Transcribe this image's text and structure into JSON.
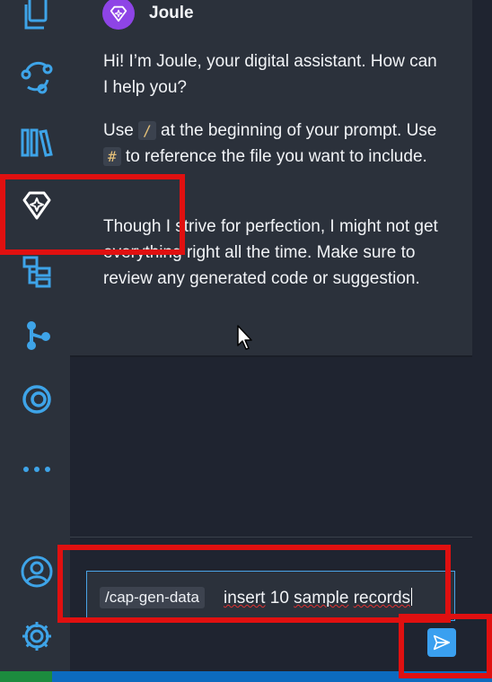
{
  "colors": {
    "activity_bg": "#2b313b",
    "panel_bg": "#1f2430",
    "accent": "#3aa0f0",
    "icon_blue": "#3ea4e8",
    "avatar_purple": "#8e44e6",
    "highlight_red": "#e01010"
  },
  "activity_bar": {
    "icons": [
      "files-icon",
      "source-graph-icon",
      "library-icon",
      "joule-diamond-icon",
      "hierarchy-tree-icon",
      "git-branch-icon",
      "copilot-at-icon",
      "more-icon",
      "account-icon",
      "settings-gear-icon"
    ],
    "active": "joule-diamond-icon"
  },
  "chat": {
    "assistant_name": "Joule",
    "greeting": "Hi! I’m Joule, your digital assistant. How can I help you?",
    "usage": {
      "use_1": "Use",
      "slash": "/",
      "after_slash": "at the beginning of your prompt.",
      "use_2": "Use",
      "hash": "#",
      "after_hash": "to reference the file you want to include."
    },
    "disclaimer": "Though I strive for perfection, I might not get everything right all the time. Make sure to review any generated code or suggestion."
  },
  "input": {
    "command": "/cap-gen-data",
    "text_words": [
      "insert",
      "10",
      "sample",
      "records"
    ]
  }
}
